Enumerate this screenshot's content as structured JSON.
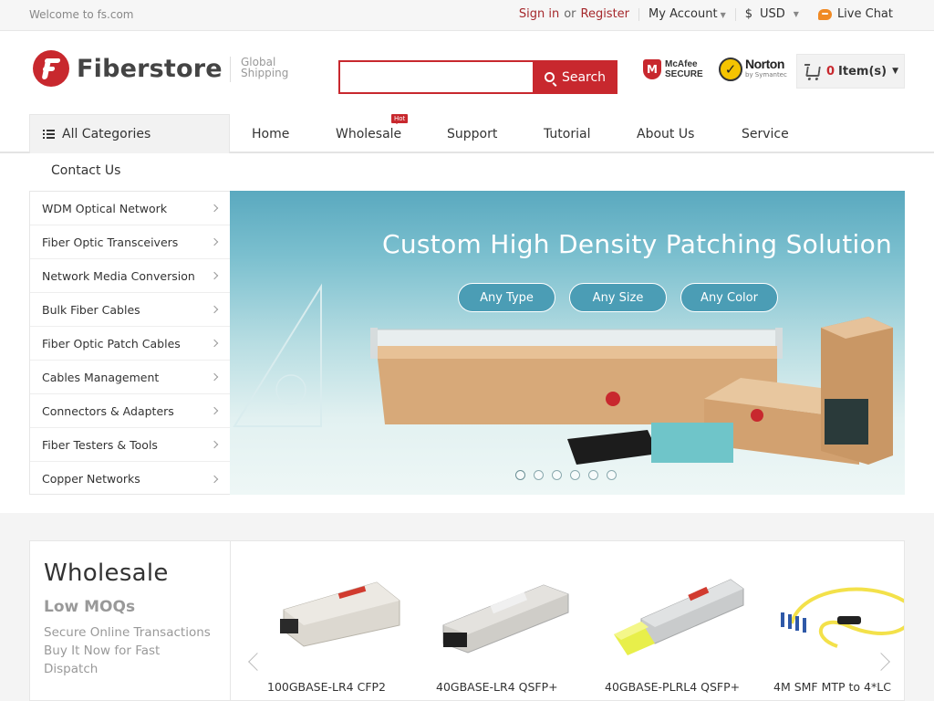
{
  "topbar": {
    "welcome": "Welcome to fs.com",
    "sign_in": "Sign in",
    "or": "or",
    "register": "Register",
    "my_account": "My Account",
    "currency_symbol": "$",
    "currency": "USD",
    "live_chat": "Live Chat"
  },
  "header": {
    "logo_text": "Fiberstore",
    "shipping_line1": "Global",
    "shipping_line2": "Shipping",
    "search_placeholder": "",
    "search_button": "Search",
    "mcafee_line1": "McAfee",
    "mcafee_line2": "SECURE",
    "norton_line1": "Norton",
    "norton_line2": "by Symantec",
    "cart_count": "0",
    "cart_label": "Item(s)"
  },
  "nav": {
    "all_categories": "All Categories",
    "items": [
      {
        "label": "Home"
      },
      {
        "label": "Wholesale",
        "badge": "Hot"
      },
      {
        "label": "Support"
      },
      {
        "label": "Tutorial"
      },
      {
        "label": "About Us"
      },
      {
        "label": "Service"
      }
    ],
    "contact": "Contact Us"
  },
  "sidebar": {
    "items": [
      {
        "label": "WDM Optical Network"
      },
      {
        "label": "Fiber Optic Transceivers"
      },
      {
        "label": "Network Media Conversion"
      },
      {
        "label": "Bulk Fiber Cables"
      },
      {
        "label": "Fiber Optic Patch Cables"
      },
      {
        "label": "Cables Management"
      },
      {
        "label": "Connectors & Adapters"
      },
      {
        "label": "Fiber Testers & Tools"
      },
      {
        "label": "Copper Networks"
      }
    ]
  },
  "banner": {
    "title": "Custom High Density Patching Solution",
    "pills": [
      "Any Type",
      "Any Size",
      "Any Color"
    ],
    "slide_count": 6,
    "active_slide": 1
  },
  "wholesale": {
    "title": "Wholesale",
    "subtitle": "Low MOQs",
    "description": "Secure Online Transactions Buy It Now for Fast Dispatch"
  },
  "products": [
    {
      "name": "100GBASE-LR4 CFP2"
    },
    {
      "name": "40GBASE-LR4 QSFP+"
    },
    {
      "name": "40GBASE-PLRL4 QSFP+"
    },
    {
      "name": "4M SMF MTP to 4*LC"
    }
  ],
  "colors": {
    "brand_red": "#c8282e",
    "banner_teal": "#5aa9bf",
    "topbar_bg": "#f6f6f6"
  }
}
